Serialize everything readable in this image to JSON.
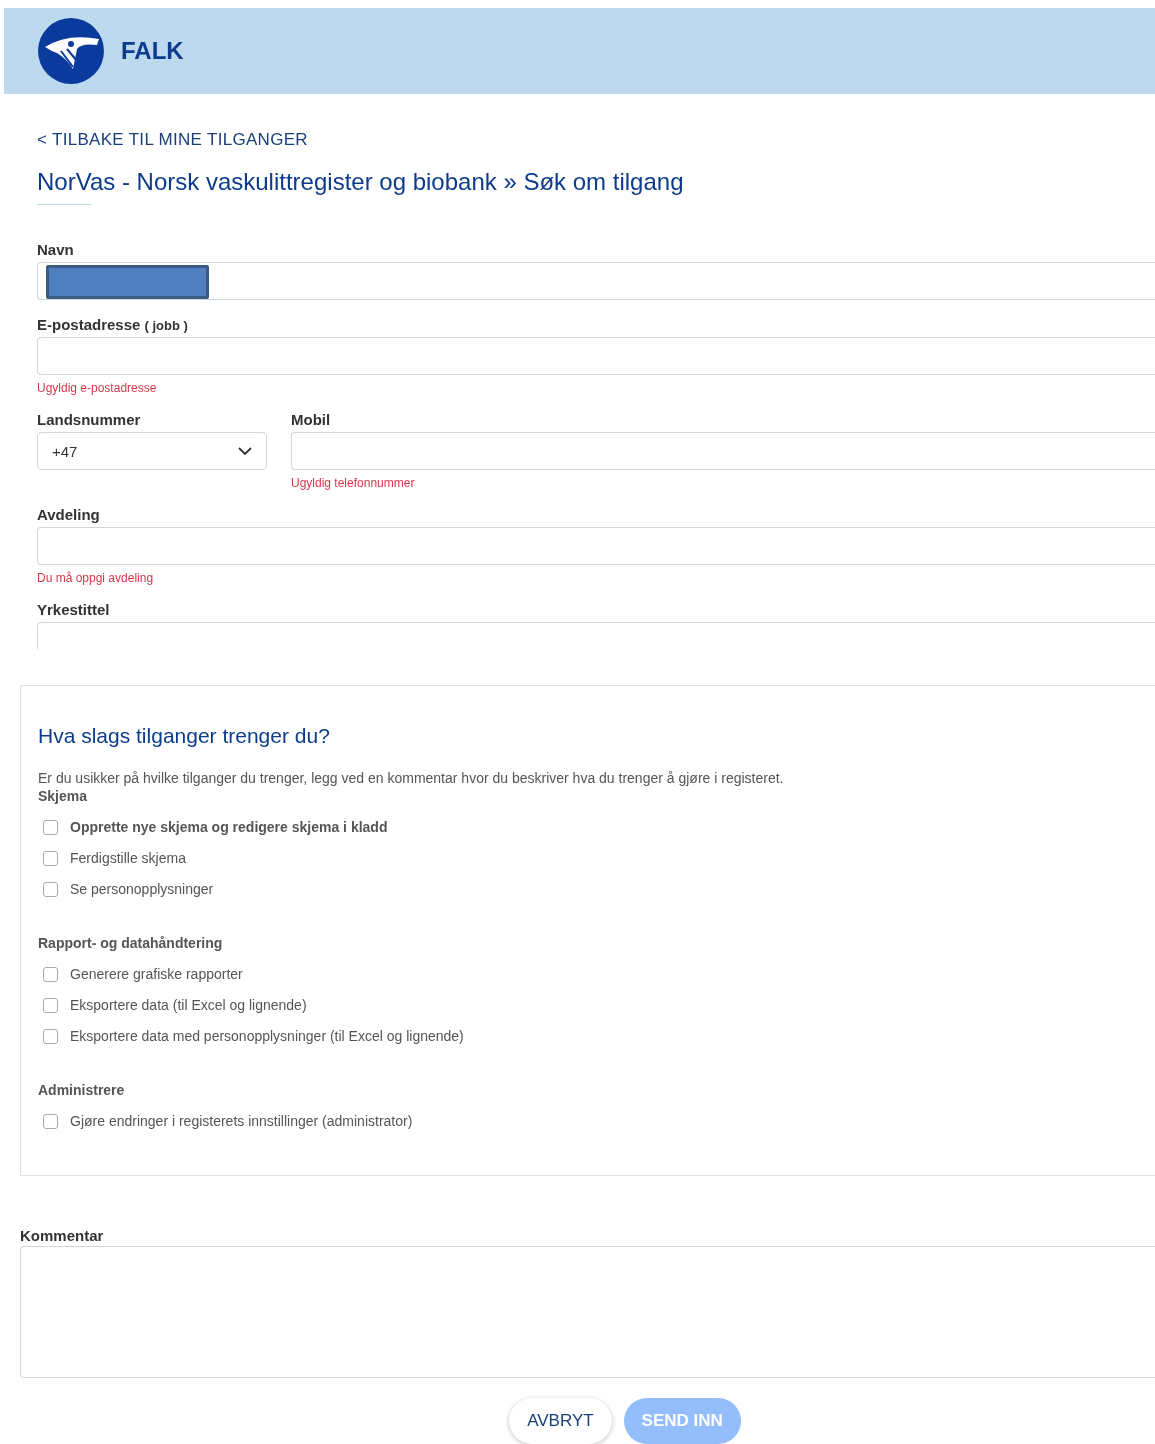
{
  "header": {
    "brand": "FALK"
  },
  "back_link": "< TILBAKE TIL MINE TILGANGER",
  "title": "NorVas - Norsk vaskulittregister og biobank » Søk om tilgang",
  "form_rows": [
    [
      {
        "kind": "text",
        "label": "Navn",
        "redacted": true
      }
    ],
    [
      {
        "kind": "text",
        "label": "E-postadresse",
        "hint": "( jobb )",
        "error": "Ugyldig e-postadresse"
      }
    ],
    [
      {
        "kind": "select",
        "label": "Landsnummer",
        "value": "+47"
      },
      {
        "kind": "text",
        "label": "Mobil",
        "error": "Ugyldig telefonnummer"
      }
    ],
    [
      {
        "kind": "text",
        "label": "Avdeling",
        "error": "Du må oppgi avdeling"
      }
    ],
    [
      {
        "kind": "text",
        "label": "Yrkestittel",
        "clipped": true
      }
    ]
  ],
  "access": {
    "heading": "Hva slags tilganger trenger du?",
    "intro": "Er du usikker på hvilke tilganger du trenger, legg ved en kommentar hvor du beskriver hva du trenger å gjøre i registeret.",
    "groups": [
      {
        "title": "Skjema",
        "options": [
          {
            "label": "Opprette nye skjema og redigere skjema i kladd",
            "checked": false,
            "highlighted": true
          },
          {
            "label": "Ferdigstille skjema",
            "checked": false,
            "highlighted": false
          },
          {
            "label": "Se personopplysninger",
            "checked": false,
            "highlighted": false
          }
        ]
      },
      {
        "title": "Rapport- og datahåndtering",
        "options": [
          {
            "label": "Generere grafiske rapporter",
            "checked": false,
            "highlighted": false
          },
          {
            "label": "Eksportere data (til Excel og lignende)",
            "checked": false,
            "highlighted": false
          },
          {
            "label": "Eksportere data med personopplysninger (til Excel og lignende)",
            "checked": false,
            "highlighted": false
          }
        ]
      },
      {
        "title": "Administrere",
        "options": [
          {
            "label": "Gjøre endringer i registerets innstillinger (administrator)",
            "checked": false,
            "highlighted": false
          }
        ]
      }
    ]
  },
  "comment": {
    "label": "Kommentar"
  },
  "buttons": [
    {
      "label": "AVBRYT",
      "kind": "secondary",
      "disabled": false
    },
    {
      "label": "SEND INN",
      "kind": "primary",
      "disabled": true
    }
  ]
}
